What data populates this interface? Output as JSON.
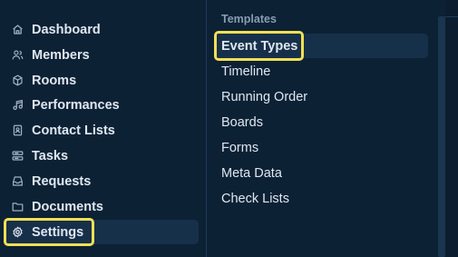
{
  "nav": {
    "items": [
      {
        "label": "Dashboard",
        "icon": "home-icon"
      },
      {
        "label": "Members",
        "icon": "users-icon"
      },
      {
        "label": "Rooms",
        "icon": "cube-icon"
      },
      {
        "label": "Performances",
        "icon": "music-note-icon"
      },
      {
        "label": "Contact Lists",
        "icon": "contact-book-icon"
      },
      {
        "label": "Tasks",
        "icon": "tasks-icon"
      },
      {
        "label": "Requests",
        "icon": "inbox-icon"
      },
      {
        "label": "Documents",
        "icon": "folder-icon"
      },
      {
        "label": "Settings",
        "icon": "gear-icon",
        "active": true
      }
    ]
  },
  "submenu": {
    "section_title": "Templates",
    "items": [
      {
        "label": "Event Types",
        "active": true
      },
      {
        "label": "Timeline"
      },
      {
        "label": "Running Order"
      },
      {
        "label": "Boards"
      },
      {
        "label": "Forms"
      },
      {
        "label": "Meta Data"
      },
      {
        "label": "Check Lists"
      }
    ]
  },
  "colors": {
    "background": "#0d2135",
    "active_background": "#17304a",
    "highlight": "#f0df55",
    "text": "#dfe7ef",
    "muted_text": "#8a9cb0"
  }
}
